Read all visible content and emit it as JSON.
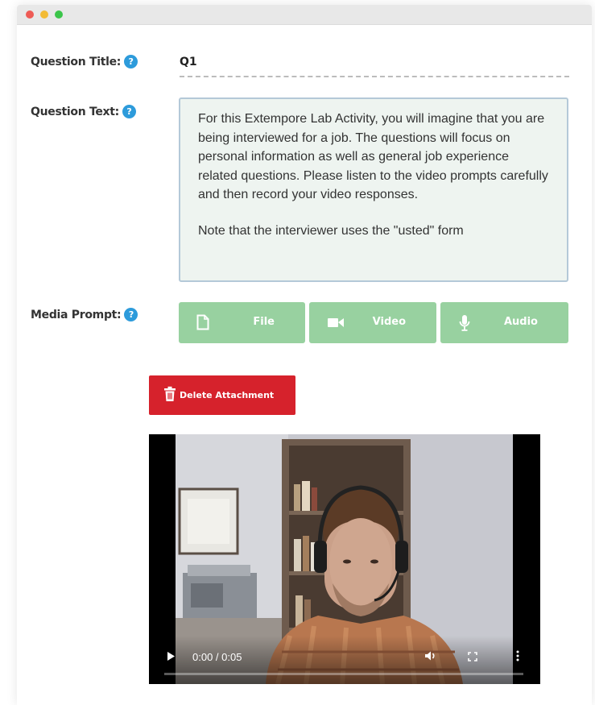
{
  "form": {
    "title_label": "Question Title:",
    "title_value": "Q1",
    "text_label": "Question Text:",
    "text_paragraphs": [
      "For this Extempore Lab Activity, you will imagine that you are being interviewed for a job. The questions will focus on personal information as well as general job experience related questions. Please listen to the video prompts carefully and then record your video responses.",
      "Note that the interviewer uses the \"usted\" form"
    ],
    "media_label": "Media Prompt:",
    "help_glyph": "?",
    "media_buttons": [
      {
        "label": "File",
        "icon": "file-icon"
      },
      {
        "label": "Video",
        "icon": "video-camera-icon"
      },
      {
        "label": "Audio",
        "icon": "microphone-icon"
      }
    ],
    "delete_label": "Delete Attachment"
  },
  "video": {
    "time": "0:00 / 0:05",
    "progress": 0
  },
  "colors": {
    "help": "#2d9bdb",
    "media_button": "#98d1a0",
    "delete_button": "#d6222c",
    "textarea_bg": "#eef4f0",
    "textarea_border": "#b4c9d8"
  }
}
